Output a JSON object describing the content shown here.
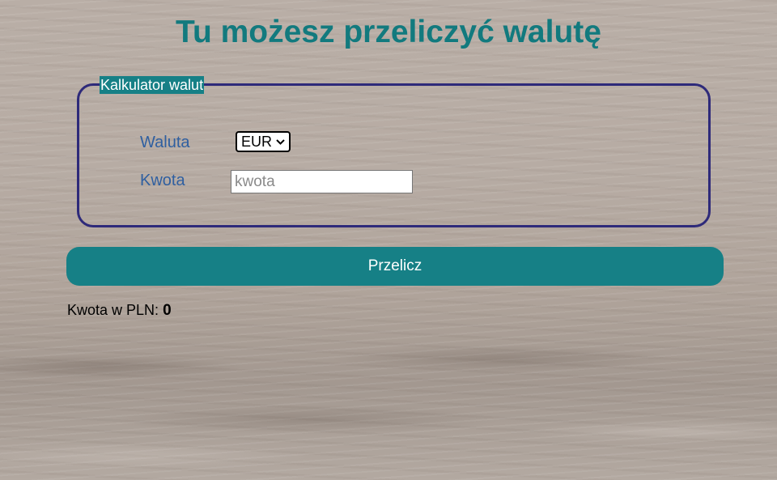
{
  "page": {
    "title": "Tu możesz przeliczyć walutę"
  },
  "form": {
    "legend": "Kalkulator walut",
    "currency_label": "Waluta",
    "currency_selected": "EUR",
    "amount_label": "Kwota",
    "amount_placeholder": "kwota",
    "submit_label": "Przelicz"
  },
  "result": {
    "label": "Kwota w PLN:",
    "value": "0"
  },
  "colors": {
    "accent": "#168086",
    "title": "#127a7e",
    "border": "#2e2a7a",
    "label": "#2f5fa0"
  },
  "icons": {
    "select_arrow": "chevron-down-icon"
  }
}
